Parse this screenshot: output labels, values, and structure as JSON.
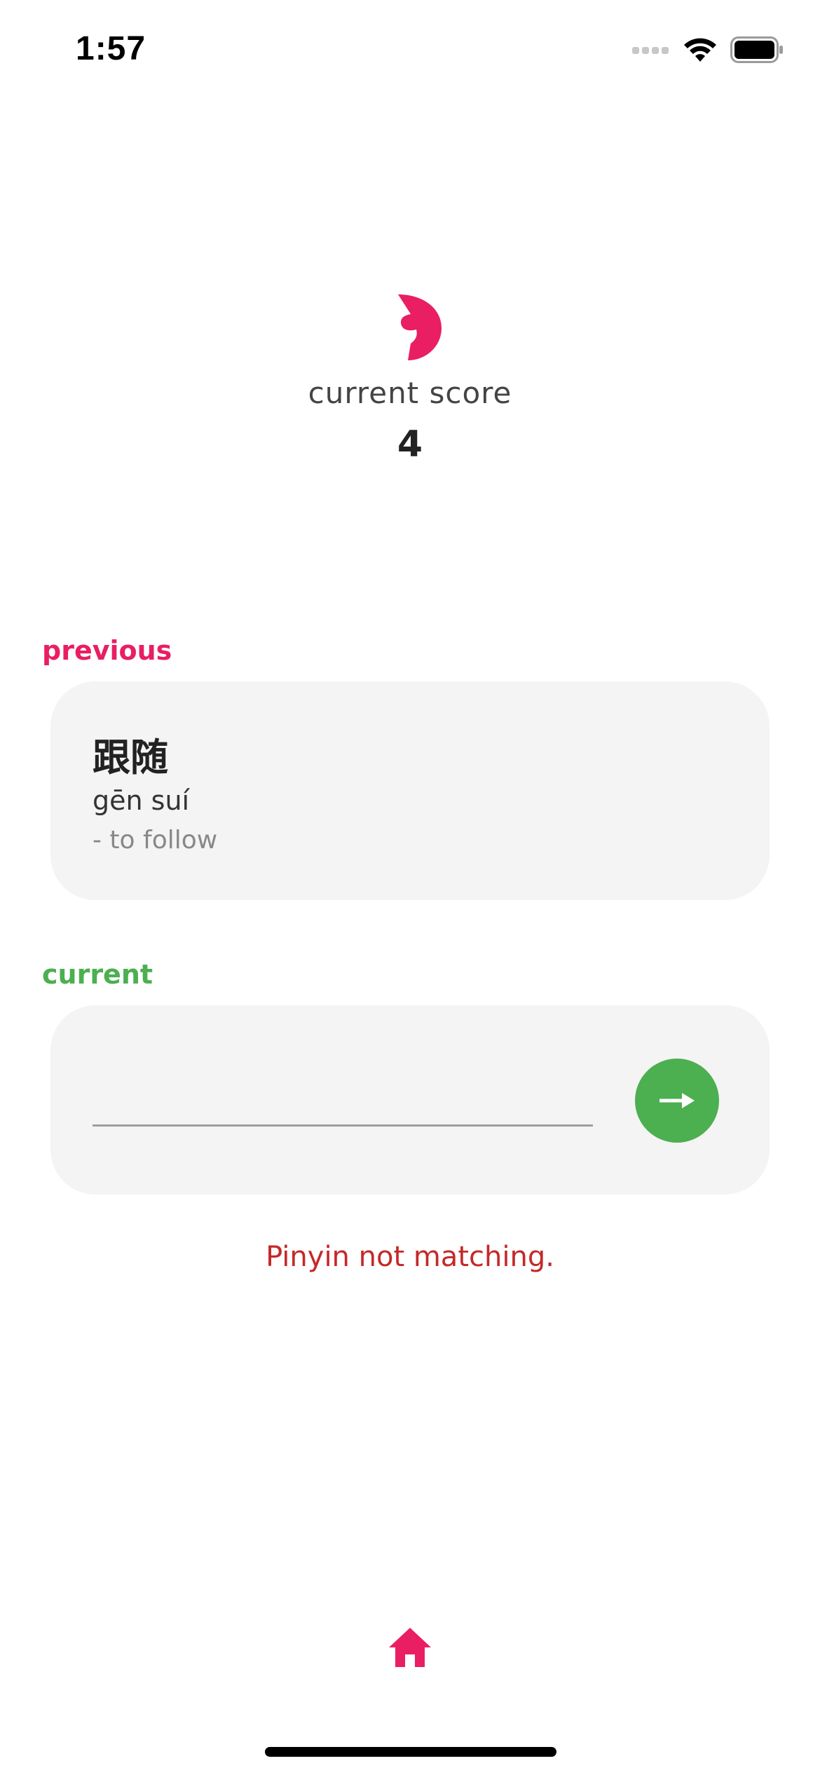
{
  "status_bar": {
    "time": "1:57"
  },
  "score": {
    "label": "current score",
    "value": "4"
  },
  "previous": {
    "label": "previous",
    "hanzi": "跟随",
    "pinyin": "gēn suí",
    "meaning": "- to follow"
  },
  "current": {
    "label": "current",
    "input_value": "",
    "submit_icon": "arrow-right-icon"
  },
  "feedback": {
    "error": "Pinyin not matching."
  },
  "nav": {
    "home_icon": "home-icon"
  },
  "colors": {
    "accent_pink": "#e91e63",
    "accent_green": "#4caf50",
    "error_red": "#c62828",
    "card_bg": "#f4f4f4"
  }
}
